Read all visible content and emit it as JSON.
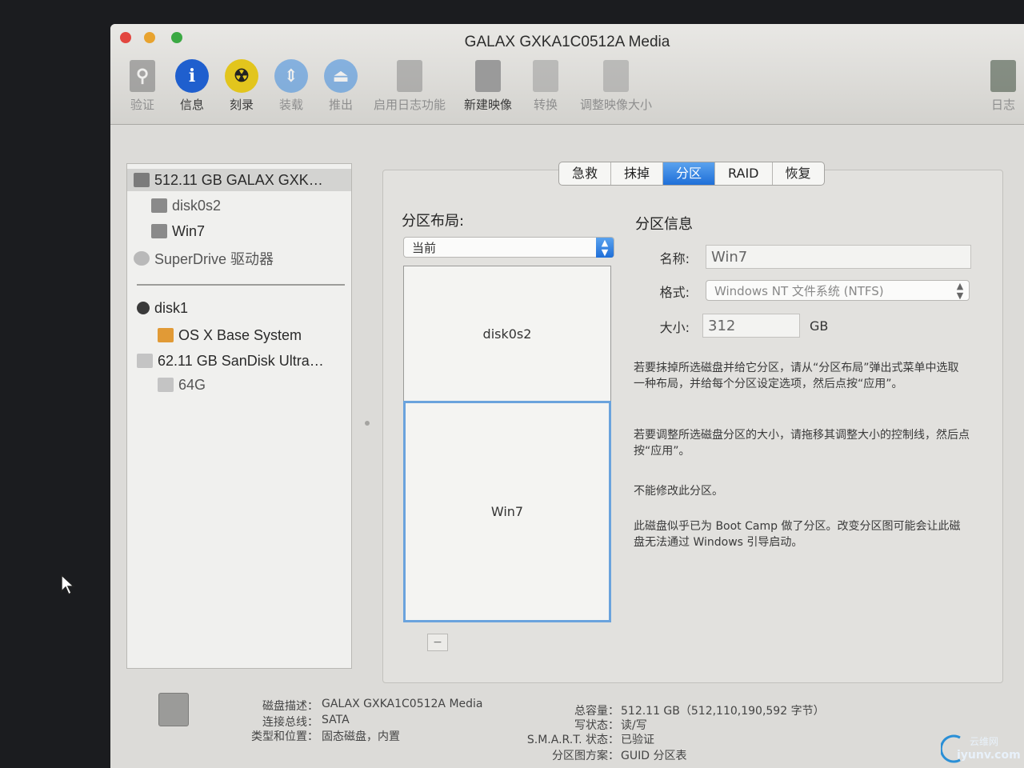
{
  "window": {
    "title": "GALAX GXKA1C0512A Media"
  },
  "toolbar": [
    {
      "label": "验证",
      "icon": "microscope-icon",
      "dim": true
    },
    {
      "label": "信息",
      "icon": "info-icon",
      "dim": false
    },
    {
      "label": "刻录",
      "icon": "burn-icon",
      "dim": false
    },
    {
      "label": "装载",
      "icon": "mount-icon",
      "dim": true
    },
    {
      "label": "推出",
      "icon": "eject-icon",
      "dim": true
    },
    {
      "label": "启用日志功能",
      "icon": "enable-journaling-icon",
      "dim": true
    },
    {
      "label": "新建映像",
      "icon": "new-image-icon",
      "dim": false
    },
    {
      "label": "转换",
      "icon": "convert-icon",
      "dim": true
    },
    {
      "label": "调整映像大小",
      "icon": "resize-image-icon",
      "dim": true
    },
    {
      "label": "日志",
      "icon": "log-icon",
      "dim": true
    }
  ],
  "sidebar": {
    "items": [
      {
        "label": "512.11 GB GALAX GXK…",
        "icon": "internal-disk-icon",
        "selected": true
      },
      {
        "label": "disk0s2",
        "icon": "volume-icon"
      },
      {
        "label": "Win7",
        "icon": "volume-icon"
      },
      {
        "label": "SuperDrive 驱动器",
        "icon": "optical-drive-icon"
      },
      {
        "label": "disk1",
        "icon": "disk-image-icon"
      },
      {
        "label": "OS X Base System",
        "icon": "orange-volume-icon"
      },
      {
        "label": "62.11 GB SanDisk Ultra…",
        "icon": "usb-disk-icon"
      },
      {
        "label": "64G",
        "icon": "volume-icon"
      }
    ]
  },
  "tabs": [
    "急救",
    "抹掉",
    "分区",
    "RAID",
    "恢复"
  ],
  "active_tab": "分区",
  "layout_section": {
    "title": "分区布局:",
    "selected_layout": "当前",
    "partitions": [
      {
        "label": "disk0s2",
        "fraction": 0.38
      },
      {
        "label": "Win7",
        "fraction": 0.62
      }
    ],
    "minus_button": "−"
  },
  "info_section": {
    "title": "分区信息",
    "name_label": "名称:",
    "name_value": "Win7",
    "format_label": "格式:",
    "format_value": "Windows NT 文件系统 (NTFS)",
    "size_label": "大小:",
    "size_value": "312",
    "size_unit": "GB",
    "help1": "若要抹掉所选磁盘并给它分区，请从“分区布局”弹出式菜单中选取一种布局，并给每个分区设定选项，然后点按“应用”。",
    "help2": "若要调整所选磁盘分区的大小，请拖移其调整大小的控制线，然后点按“应用”。",
    "help3": "不能修改此分区。",
    "help4": "此磁盘似乎已为 Boot Camp 做了分区。改变分区图可能会让此磁盘无法通过 Windows 引导启动。"
  },
  "footer": {
    "desc_label": "磁盘描述：",
    "desc_value": "GALAX GXKA1C0512A Media",
    "bus_label": "连接总线：",
    "bus_value": "SATA",
    "type_label": "类型和位置：",
    "type_value": "固态磁盘，内置",
    "capacity_label": "总容量：",
    "capacity_value": "512.11 GB（512,110,190,592 字节）",
    "write_label": "写状态：",
    "write_value": "读/写",
    "smart_label": "S.M.A.R.T. 状态：",
    "smart_value": "已验证",
    "scheme_label": "分区图方案：",
    "scheme_value": "GUID 分区表"
  },
  "watermark": {
    "line1": "云维网",
    "line2": "iyunv.com"
  }
}
